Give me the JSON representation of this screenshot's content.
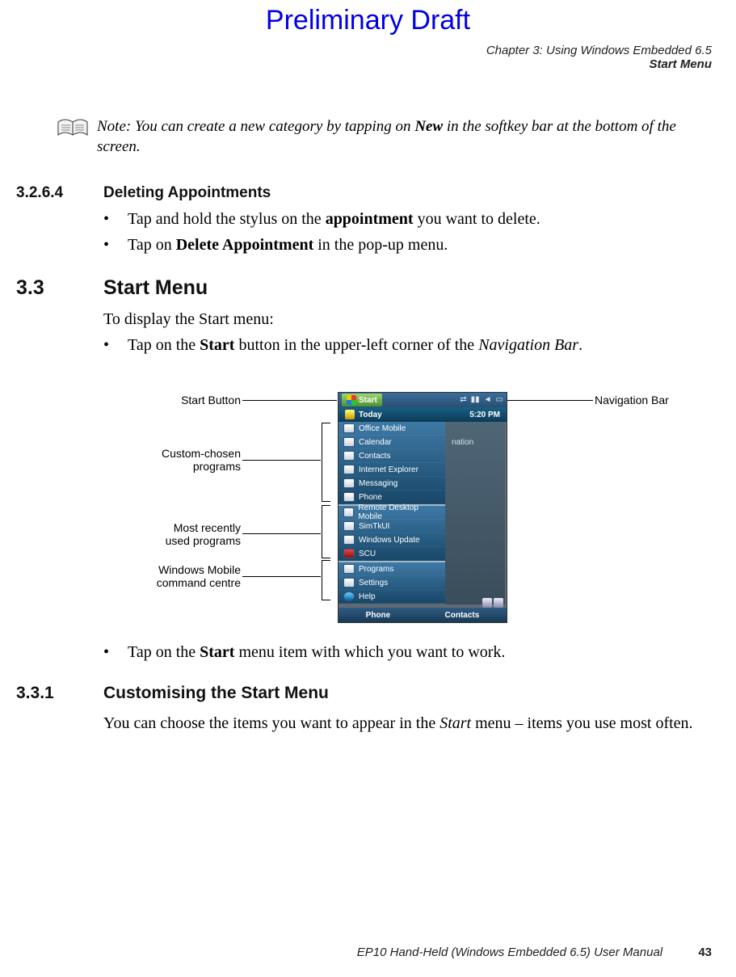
{
  "draft_watermark": "Preliminary Draft",
  "header": {
    "chapter": "Chapter 3: Using Windows Embedded 6.5",
    "section": "Start Menu"
  },
  "note": {
    "prefix": "Note:",
    "text_before_bold": " You can create a new category by tapping on ",
    "bold": "New",
    "text_after_bold": " in the softkey bar at the bottom of the screen."
  },
  "sec_32_6_4": {
    "num": "3.2.6.4",
    "title": "Deleting Appointments"
  },
  "bullets_32_6_4": {
    "b1a": "Tap and hold the stylus on the ",
    "b1b": "appointment",
    "b1c": " you want to delete.",
    "b2a": "Tap on ",
    "b2b": "Delete Appointment",
    "b2c": " in the pop-up menu."
  },
  "sec_3_3": {
    "num": "3.3",
    "title": "Start Menu"
  },
  "p_3_3_intro": "To display the Start menu:",
  "bullets_3_3": {
    "b1a": "Tap on the ",
    "b1b": "Start",
    "b1c": " button in the upper-left corner of the ",
    "b1d": "Navigation Bar",
    "b1e": "."
  },
  "callouts": {
    "start_button": "Start Button",
    "nav_bar": "Navigation Bar",
    "custom1": "Custom-chosen",
    "custom2": "programs",
    "mru1": "Most recently",
    "mru2": "used programs",
    "wm1": "Windows Mobile",
    "wm2": "command centre"
  },
  "device": {
    "start": "Start",
    "today": "Today",
    "time": "5:20 PM",
    "right_anno": "nation",
    "items_custom": [
      "Office Mobile",
      "Calendar",
      "Contacts",
      "Internet Explorer",
      "Messaging",
      "Phone"
    ],
    "items_mru": [
      "Remote Desktop Mobile",
      "SimTkUI",
      "Windows Update",
      "SCU"
    ],
    "items_wm": [
      "Programs",
      "Settings",
      "Help"
    ],
    "soft_left": "Phone",
    "soft_right": "Contacts"
  },
  "bullets_3_3_after": {
    "b1a": "Tap on the ",
    "b1b": "Start",
    "b1c": " menu item with which you want to work."
  },
  "sec_3_3_1": {
    "num": "3.3.1",
    "title": "Customising the Start Menu"
  },
  "p_3_3_1_a": "You can choose the items you want to appear in the ",
  "p_3_3_1_b": "Start",
  "p_3_3_1_c": " menu – items you use most often.",
  "footer": {
    "doc": "EP10 Hand-Held (Windows Embedded 6.5) User Manual",
    "page": "43"
  }
}
